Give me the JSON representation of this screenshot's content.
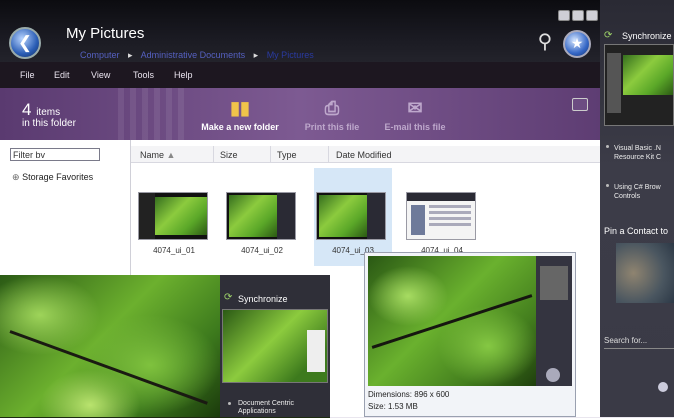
{
  "window": {
    "title": "My Pictures",
    "breadcrumb": [
      "Computer",
      "Administrative Documents",
      "My Pictures"
    ]
  },
  "menu": [
    "File",
    "Edit",
    "View",
    "Tools",
    "Help"
  ],
  "commandbar": {
    "count": "4",
    "count_unit": "items",
    "count_sub": "in this folder",
    "new_folder": "Make a new folder",
    "print_file": "Print this file",
    "email_file": "E-mail this file"
  },
  "nav": {
    "filter_value": "Filter bv",
    "favorites": "Storage Favorites"
  },
  "columns": [
    "Name",
    "Size",
    "Type",
    "Date Modified"
  ],
  "files": [
    "4074_ui_01",
    "4074_ui_02",
    "4074_ui_03",
    "4074_ui_04"
  ],
  "sidebar": {
    "sync_title": "Synchronize",
    "item1": "Visual Basic .N Resource Kit C",
    "item2": "Using C# Brow Controls",
    "pin_contact": "Pin a Contact to",
    "search": "Search for..."
  },
  "overlay": {
    "sync_title": "Synchronize",
    "item": "Document Centric Applications"
  },
  "preview": {
    "dimensions": "Dimensions: 896 x 600",
    "size": "Size: 1.53 MB"
  },
  "icons": {
    "back": "back-arrow-icon",
    "search": "magnifier-icon",
    "star": "favorites-star-icon",
    "new_folder": "folder-icon",
    "print": "printer-icon",
    "email": "envelope-icon"
  },
  "colors": {
    "command_bar": "#7d5a92",
    "selection": "#d6e7f7",
    "sidebar": "#3c3c48"
  }
}
